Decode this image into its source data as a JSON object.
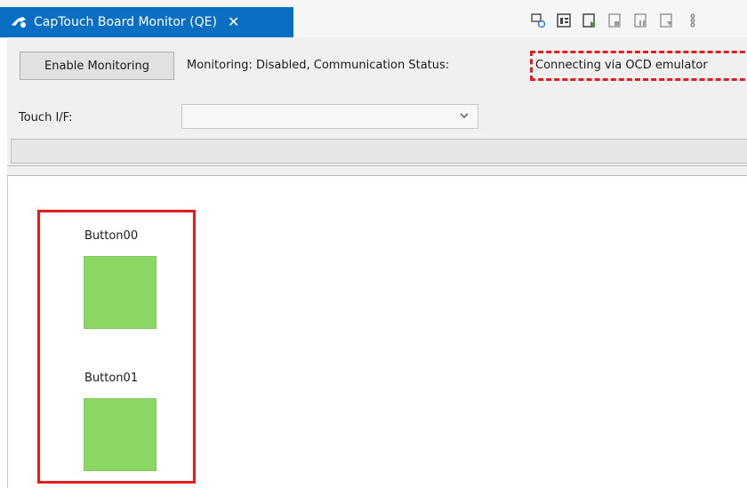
{
  "tab": {
    "title": "CapTouch Board Monitor (QE)",
    "close_glyph": "✕"
  },
  "toolbar": {
    "icons": [
      "connect-icon",
      "view-list-icon",
      "run-icon",
      "step-icon",
      "pause-icon",
      "stop-icon",
      "more-icon"
    ]
  },
  "monitoring": {
    "enable_label": "Enable Monitoring",
    "status_prefix": "Monitoring: Disabled, Communication Status:",
    "status_value": "Connecting via OCD emulator"
  },
  "touch_if": {
    "label": "Touch I/F:",
    "selected_value": ""
  },
  "buttons": [
    {
      "label": "Button00",
      "state_color": "#8dd765"
    },
    {
      "label": "Button01",
      "state_color": "#8dd765"
    }
  ],
  "colors": {
    "tab_bg": "#0a6ec2",
    "highlight": "#e11d1d",
    "button_green": "#8dd765"
  }
}
